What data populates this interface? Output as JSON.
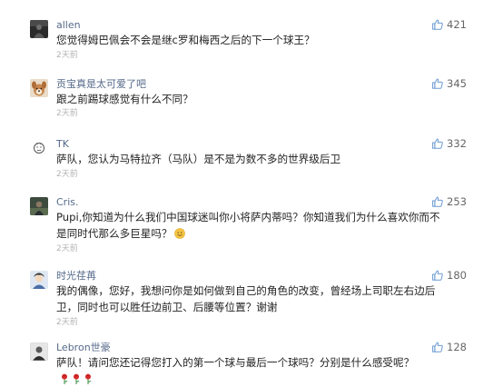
{
  "colors": {
    "username": "#556a8a",
    "like_icon": "#6b9bd2",
    "time": "#b3b3b3",
    "text": "#222222"
  },
  "comments": [
    {
      "username": "allen",
      "text": "您觉得姆巴佩会不会是继c罗和梅西之后的下一个球王？",
      "time": "2天前",
      "likes": "421",
      "avatar_icon": "dark-figure-avatar"
    },
    {
      "username": "贡宝真是太可爱了吧",
      "text": "跟之前踢球感觉有什么不同？",
      "time": "2天前",
      "likes": "345",
      "avatar_icon": "dog-avatar"
    },
    {
      "username": "TK",
      "text": "萨队，您认为马特拉齐（马队）是不是为数不多的世界级后卫",
      "time": "2天前",
      "likes": "332",
      "avatar_icon": "default-avatar"
    },
    {
      "username": "Cris.",
      "text": "Pupi,你知道为什么我们中国球迷叫你小将萨内蒂吗？你知道我们为什么喜欢你而不是同时代那么多巨星吗？",
      "time": "2天前",
      "likes": "253",
      "avatar_icon": "photo-avatar",
      "emoji": "smile-emoji"
    },
    {
      "username": "时光荏苒",
      "text": "我的偶像，您好，我想问你是如何做到自己的角色的改变，曾经场上司职左右边后卫，同时也可以胜任边前卫、后腰等位置？谢谢",
      "time": "2天前",
      "likes": "180",
      "avatar_icon": "cartoon-avatar"
    },
    {
      "username": "Lebron世豪",
      "text": "萨队！请问您还记得您打入的第一个球与最后一个球吗？分别是什么感受呢？",
      "time": "2天前",
      "likes": "128",
      "avatar_icon": "bw-photo-avatar",
      "trailing_icons": [
        "rose-icon",
        "rose-icon",
        "rose-icon"
      ]
    }
  ]
}
